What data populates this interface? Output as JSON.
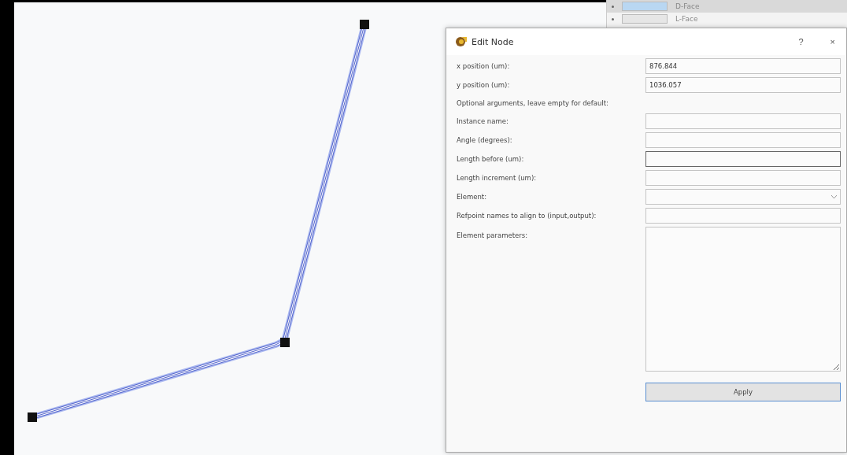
{
  "layers": [
    {
      "name": "D-Face",
      "color": "#b9d7f2",
      "selected": true
    },
    {
      "name": "L-Face",
      "color": "#e6e6e6",
      "selected": false
    }
  ],
  "dialog": {
    "title": "Edit Node",
    "help": "?",
    "close": "×",
    "fields": [
      {
        "kind": "text",
        "label": "x position (um):",
        "value": "876.844",
        "focused": false
      },
      {
        "kind": "text",
        "label": "y position (um):",
        "value": "1036.057",
        "focused": false
      },
      {
        "kind": "note",
        "label": "Optional arguments, leave empty for default:"
      },
      {
        "kind": "text",
        "label": "Instance name:",
        "focused": false
      },
      {
        "kind": "text",
        "label": "Angle (degrees):",
        "focused": false
      },
      {
        "kind": "text",
        "label": "Length before (um):",
        "focused": true
      },
      {
        "kind": "text",
        "label": "Length increment (um):",
        "focused": false
      },
      {
        "kind": "select",
        "label": "Element:",
        "focused": false
      },
      {
        "kind": "text",
        "label": "Refpoint names to align to (input,output):",
        "focused": false
      },
      {
        "kind": "textarea",
        "label": "Element parameters:",
        "focused": false
      }
    ],
    "button": "Apply"
  }
}
